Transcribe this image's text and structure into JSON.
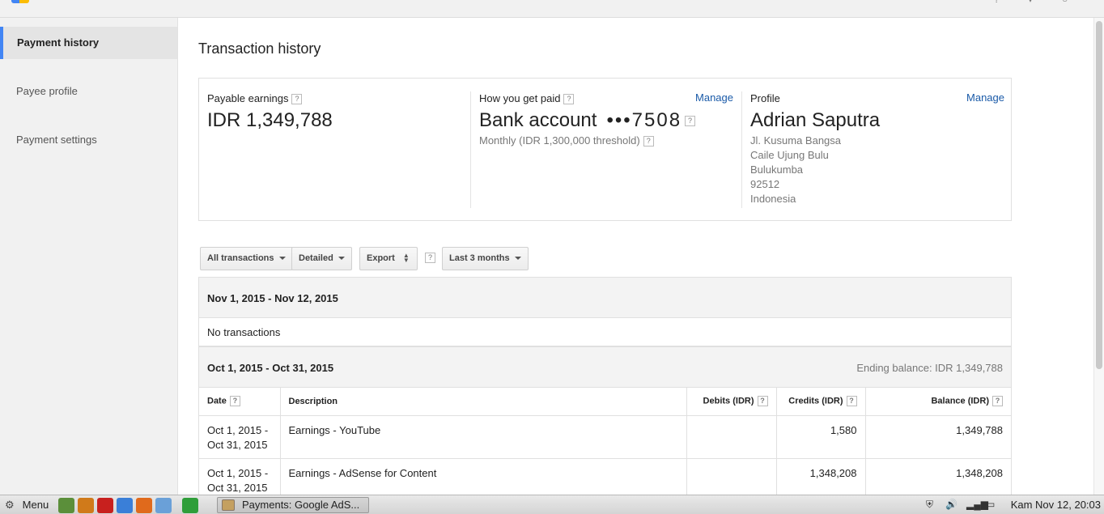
{
  "topbar": {
    "icons": [
      "help-icon",
      "notifications-icon",
      "account-icon"
    ]
  },
  "sidebar": {
    "items": [
      {
        "label": "Payment history",
        "active": true
      },
      {
        "label": "Payee profile",
        "active": false
      },
      {
        "label": "Payment settings",
        "active": false
      }
    ]
  },
  "main": {
    "title": "Transaction history",
    "summary": {
      "earnings": {
        "label": "Payable earnings",
        "help": "?",
        "value": "IDR 1,349,788"
      },
      "payment": {
        "label": "How you get paid",
        "help": "?",
        "manage": "Manage",
        "method": "Bank account",
        "masked": "•••7508",
        "help2": "?",
        "schedule": "Monthly (IDR 1,300,000 threshold)",
        "help3": "?"
      },
      "profile": {
        "label": "Profile",
        "manage": "Manage",
        "name": "Adrian Saputra",
        "address": [
          "Jl. Kusuma Bangsa",
          "Caile Ujung Bulu",
          "Bulukumba",
          "92512",
          "Indonesia"
        ]
      }
    },
    "filters": {
      "type": "All transactions",
      "detail": "Detailed",
      "export": "Export",
      "help": "?",
      "range": "Last 3 months"
    },
    "periods": [
      {
        "title": "Nov 1, 2015 - Nov 12, 2015",
        "empty_text": "No transactions"
      },
      {
        "title": "Oct 1, 2015 - Oct 31, 2015",
        "ending_balance": "Ending balance: IDR 1,349,788"
      }
    ],
    "table": {
      "headers": {
        "date": "Date",
        "description": "Description",
        "debits": "Debits (IDR)",
        "credits": "Credits (IDR)",
        "balance": "Balance (IDR)",
        "help": "?"
      },
      "rows": [
        {
          "date_start": "Oct 1, 2015 -",
          "date_end": "Oct 31, 2015",
          "description": "Earnings - YouTube",
          "debits": "",
          "credits": "1,580",
          "balance": "1,349,788"
        },
        {
          "date_start": "Oct 1, 2015 -",
          "date_end": "Oct 31, 2015",
          "description": "Earnings - AdSense for Content",
          "debits": "",
          "credits": "1,348,208",
          "balance": "1,348,208"
        }
      ]
    }
  },
  "taskbar": {
    "menu_label": "Menu",
    "launchers": [
      {
        "name": "terminal-icon",
        "color": "#5b8f3a"
      },
      {
        "name": "media-player-icon",
        "color": "#d07a1a"
      },
      {
        "name": "opera-icon",
        "color": "#c8201e"
      },
      {
        "name": "chrome-icon",
        "color": "#3a7fd8"
      },
      {
        "name": "firefox-icon",
        "color": "#e06a1c"
      },
      {
        "name": "user-icon",
        "color": "#6aa0d8"
      },
      {
        "name": "spreadsheet-icon",
        "color": "#2f9e3a"
      }
    ],
    "task_label": "Payments: Google AdS...",
    "clock": "Kam Nov 12, 20:03"
  }
}
